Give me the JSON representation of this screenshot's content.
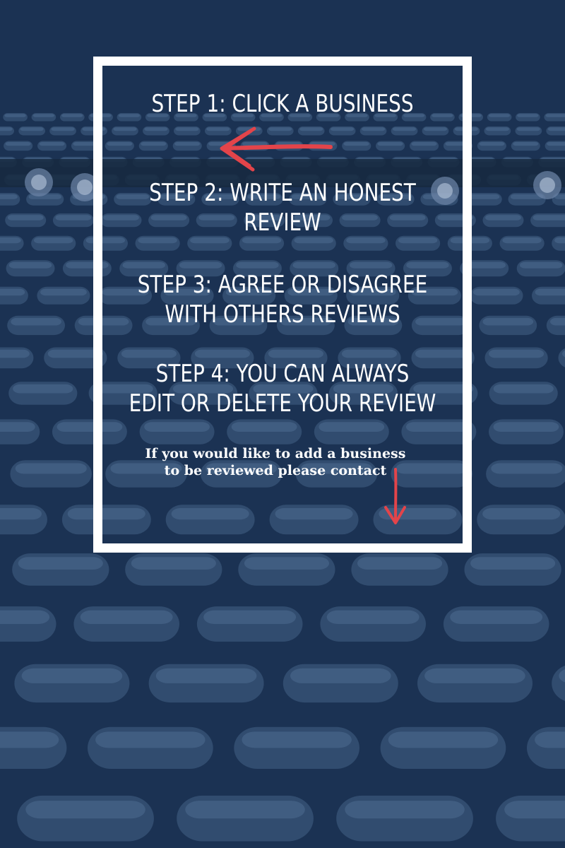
{
  "background": {
    "scene": "theater-seating-icon",
    "tint": "#1b3253",
    "seat_color": "#3a5578"
  },
  "accent": "#e3444a",
  "steps": [
    {
      "lines": [
        "STEP 1: CLICK A BUSINESS"
      ]
    },
    {
      "lines": [
        "STEP 2: WRITE AN HONEST",
        "REVIEW"
      ]
    },
    {
      "lines": [
        "STEP 3: AGREE OR DISAGREE",
        "WITH OTHERS REVIEWS"
      ]
    },
    {
      "lines": [
        "STEP 4: YOU CAN ALWAYS",
        "EDIT OR DELETE YOUR REVIEW"
      ]
    }
  ],
  "note": {
    "lines": [
      "If you would like to add a business",
      "to be reviewed please contact"
    ]
  },
  "icons": {
    "left_arrow": "arrow-left-icon",
    "down_arrow": "arrow-down-icon"
  }
}
